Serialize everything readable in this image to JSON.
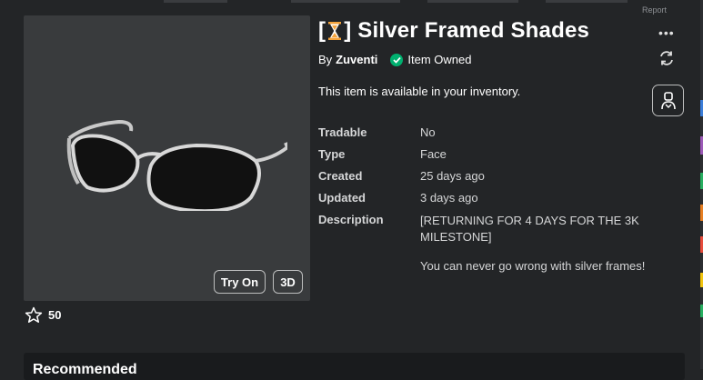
{
  "header": {
    "report_label": "Report"
  },
  "item": {
    "title_open": "[",
    "title_close": "] Silver Framed Shades",
    "by_label": "By",
    "creator": "Zuventi",
    "owned_label": "Item Owned",
    "availability": "This item is available in your inventory.",
    "more_menu": "•••"
  },
  "preview": {
    "try_on_label": "Try On",
    "view3d_label": "3D",
    "favorites": "50"
  },
  "details": {
    "rows": [
      {
        "label": "Tradable",
        "value": "No"
      },
      {
        "label": "Type",
        "value": "Face"
      },
      {
        "label": "Created",
        "value": "25 days ago"
      },
      {
        "label": "Updated",
        "value": "3 days ago"
      }
    ],
    "description_label": "Description",
    "description_p1": "[RETURNING FOR 4 DAYS FOR THE 3K MILESTONE]",
    "description_p2": "You can never go wrong with silver frames!"
  },
  "recommended": {
    "heading": "Recommended"
  },
  "colors": {
    "background": "#232527",
    "preview_bg": "#393b3d",
    "owned_check": "#00b06f",
    "hourglass": "#f4a33c"
  }
}
